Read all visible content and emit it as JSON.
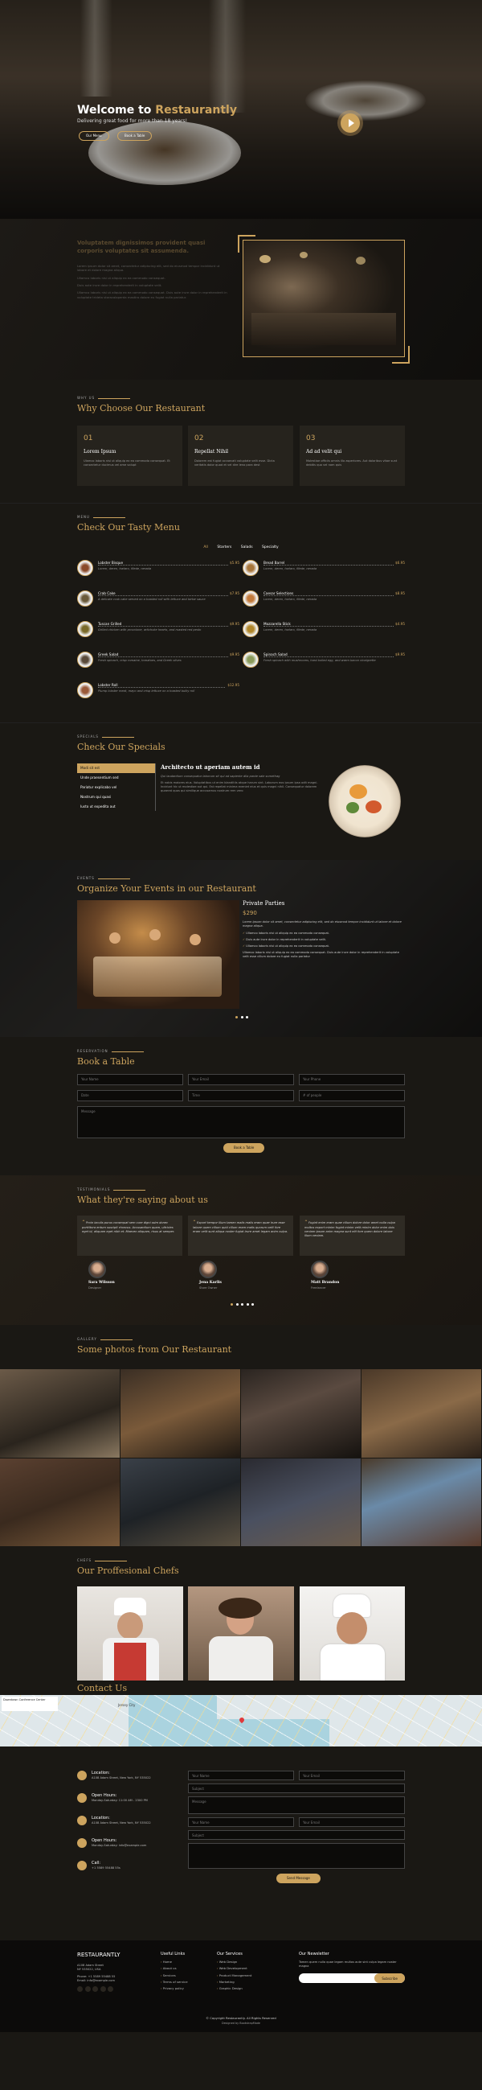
{
  "hero": {
    "title_pre": "Welcome to ",
    "title_brand": "Restaurantly",
    "subtitle": "Delivering great food for more than 18 years!",
    "btn_menu": "Our Menu",
    "btn_book": "Book a Table"
  },
  "about": {
    "title": "Voluptatem dignissimos provident quasi corporis voluptates sit assumenda.",
    "lines": [
      "Lorem ipsum dolor sit amet, consectetur adipiscing elit, sed do eiusmod tempor incididunt ut labore et dolore magna aliqua.",
      "Ullamco laboris nisi ut aliquip ex ea commodo consequat.",
      "Duis aute irure dolor in reprehenderit in voluptate velit.",
      "Ullamco laboris nisi ut aliquip ex ea commodo consequat. Duis aute irure dolor in reprehenderit in voluptate trideta storacalaperda mastiro dolore eu fugiat nulla pariatur."
    ]
  },
  "why": {
    "kicker": "Why Us",
    "title": "Why Choose Our Restaurant",
    "boxes": [
      {
        "num": "01",
        "title": "Lorem Ipsum",
        "text": "Ulamco laboris nisi ut aliquip ex ea commodo consequat. Et consectetur ducimus vel ame volupt"
      },
      {
        "num": "02",
        "title": "Repellat Nihil",
        "text": "Dolorem est fugiat occaecati voluptate velit esse. Dicta veritatis dolor quod et vel dire leno para dest"
      },
      {
        "num": "03",
        "title": "Ad ad velit qui",
        "text": "Molestiae officiis omnis illo asperiores. Aut doloribus vitae sunt debitis quo vel nam quis"
      }
    ]
  },
  "menu": {
    "kicker": "Menu",
    "title": "Check Our Tasty Menu",
    "filters": [
      "All",
      "Starters",
      "Salads",
      "Specialty"
    ],
    "items": [
      {
        "name": "Lobster Bisque",
        "price": "$5.95",
        "desc": "Lorem, deren, trataro, filede, nerada"
      },
      {
        "name": "Bread Barrel",
        "price": "$6.95",
        "desc": "Lorem, deren, trataro, filede, nerada"
      },
      {
        "name": "Crab Cake",
        "price": "$7.95",
        "desc": "A delicate crab cake served on a toasted roll with lettuce and tartar sauce"
      },
      {
        "name": "Caesar Selections",
        "price": "$8.95",
        "desc": "Lorem, deren, trataro, filede, nerada"
      },
      {
        "name": "Tuscan Grilled",
        "price": "$9.95",
        "desc": "Grilled chicken with provolone, artichoke hearts, and roasted red pesto"
      },
      {
        "name": "Mozzarella Stick",
        "price": "$4.95",
        "desc": "Lorem, deren, trataro, filede, nerada"
      },
      {
        "name": "Greek Salad",
        "price": "$9.95",
        "desc": "Fresh spinach, crisp romaine, tomatoes, and Greek olives"
      },
      {
        "name": "Spinach Salad",
        "price": "$9.95",
        "desc": "Fresh spinach with mushrooms, hard boiled egg, and warm bacon vinaigrette"
      },
      {
        "name": "Lobster Roll",
        "price": "$12.95",
        "desc": "Plump lobster meat, mayo and crisp lettuce on a toasted bulky roll"
      }
    ]
  },
  "specials": {
    "kicker": "Specials",
    "title": "Check Our Specials",
    "tabs": [
      "Modi sit est",
      "Unde praesentium sed",
      "Pariatur explicabo vel",
      "Nostrum qui quasi",
      "Iusto ut expedita aut"
    ],
    "heading": "Architecto ut aperiam autem id",
    "italic": "Qui laudantium consequatur laborum sit qui ad sapiente dila parde sale somethag",
    "text": "Et nobis maiores eius. Voluptatibus ut enim blanditiis atque harum sint. Laborum eos ipsum ipsa odit magni. Incidunt hic ut molestiae aut qui. Est repellat minima eveniet eius et quis magni nihil. Consequatur dolorem quaerat quos qui similique accusamus nostrum rem vero"
  },
  "events": {
    "kicker": "Events",
    "title": "Organize Your Events in our Restaurant",
    "heading": "Private Parties",
    "price": "$290",
    "italic": "Lorem ipsum dolor sit amet, consectetur adipiscing elit, sed do eiusmod tempor incididunt ut labore et dolore magna aliqua.",
    "bullets": [
      "Ullamco laboris nisi ut aliquip ex ea commodo consequat.",
      "Duis aute irure dolor in reprehenderit in voluptate velit.",
      "Ullamco laboris nisi ut aliquip ex ea commodo consequat."
    ],
    "text": "Ullamco laboris nisi ut aliquip ex ea commodo consequat. Duis aute irure dolor in reprehenderit in voluptate velit esse cillum dolore eu fugiat nulla pariatur"
  },
  "booking": {
    "kicker": "Reservation",
    "title": "Book a Table",
    "fields": [
      "Your Name",
      "Your Email",
      "Your Phone",
      "Date",
      "Time",
      "# of people"
    ],
    "message": "Message",
    "submit": "Book a Table"
  },
  "testimonials": {
    "kicker": "Testimonials",
    "title": "What they're saying about us",
    "items": [
      {
        "quote": "Proin iaculis purus consequat sem cure digni ssim donec porttitora entum suscipit rhoncus. Accusantium quam, ultricies eget id, aliquam eget nibh et. Maecen aliquam, risus at semper.",
        "name": "Sara Wilsson",
        "role": "Designer"
      },
      {
        "quote": "Export tempor illum tamen malis malis eram quae irure esse labore quem cillum quid cillum eram malis quorum velit fore eram velit sunt aliqua noster fugiat irure amet legam anim culpa.",
        "name": "Jena Karlis",
        "role": "Store Owner"
      },
      {
        "quote": "Fugiat enim eram quae cillum dolore dolor amet nulla culpa multos export minim fugiat minim velit minim dolor enim duis veniam ipsum anim magna sunt elit fore quem dolore labore illum veniam.",
        "name": "Matt Brandon",
        "role": "Freelancer"
      }
    ]
  },
  "gallery": {
    "kicker": "Gallery",
    "title": "Some photos from Our Restaurant"
  },
  "chefs": {
    "kicker": "Chefs",
    "title": "Our Proffesional Chefs"
  },
  "contact": {
    "title": "Contact Us",
    "map_title": "Downtown Conference Center",
    "map_label": "Jersey City",
    "info": [
      {
        "label": "Location:",
        "text": "A108 Adam Street, New York, NY 535022"
      },
      {
        "label": "Open Hours:",
        "text": "Monday-Saturday: 11:00 AM - 2300 PM"
      },
      {
        "label": "Location:",
        "text": "A108 Adam Street, New York, NY 535022"
      },
      {
        "label": "Open Hours:",
        "text": "Monday-Saturday: info@example.com"
      },
      {
        "label": "Call:",
        "text": "+1 5589 55488 55s"
      }
    ],
    "form": [
      "Your Name",
      "Your Email",
      "Subject",
      "Message"
    ],
    "form2": [
      "Your Name",
      "Your Email",
      "Subject"
    ],
    "submit": "Send Message"
  },
  "footer": {
    "brand": "RESTAURANTLY",
    "address": [
      "A108 Adam Street",
      "NY 535022, USA"
    ],
    "phone": "Phone: +1 5589 55488 55",
    "email": "Email: info@example.com",
    "col1_title": "Useful Links",
    "col1": [
      "Home",
      "About us",
      "Services",
      "Terms of service",
      "Privacy policy"
    ],
    "col2_title": "Our Services",
    "col2": [
      "Web Design",
      "Web Development",
      "Product Management",
      "Marketing",
      "Graphic Design"
    ],
    "col3_title": "Our Newsletter",
    "col3_text": "Tamen quem nulla quae legam multos aute sint culpa legam noster magna",
    "subscribe": "Subscribe",
    "copyright": "© Copyright Restaurantly. All Rights Reserved",
    "credit": "Designed by BootstrapMade"
  }
}
